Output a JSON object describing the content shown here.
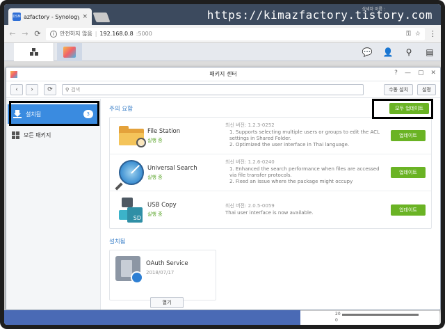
{
  "browser": {
    "tab_title": "azfactory - Synology Di",
    "tab_close": "×",
    "favicon_text": "DSM",
    "watermark": "https://kimazfactory.tistory.com",
    "watermark_small": "상세차 이름 :",
    "security_label": "안전하지 않음",
    "url_host": "192.168.0.8",
    "url_port": ":5000"
  },
  "window": {
    "title": "패키지 센터",
    "search_placeholder": "검색",
    "manual_install": "수동 설치",
    "settings": "설정"
  },
  "sidebar": {
    "installed_label": "설치됨",
    "installed_count": "3",
    "all_packages_label": "모든 패키지"
  },
  "attention": {
    "title": "주의 요함",
    "update_all": "모두 업데이트",
    "packages": [
      {
        "name": "File Station",
        "status": "실행 중",
        "version_line": "최신 버전: 1.2.3-0252",
        "notes": "1. Supports selecting multiple users or groups to edit the ACL settings in Shared Folder.\n2. Optimized the user interface in Thai language.",
        "update": "업데이트"
      },
      {
        "name": "Universal Search",
        "status": "실행 중",
        "version_line": "최신 버전: 1.2.6-0240",
        "notes": "1. Enhanced the search performance when files are accessed via file transfer protocols.\n2. Fixed an issue where the package might occupy",
        "update": "업데이트"
      },
      {
        "name": "USB Copy",
        "status": "실행 중",
        "version_line": "최신 버전: 2.0.5-0059",
        "notes": "Thai user interface is now available.",
        "update": "업데이트"
      }
    ]
  },
  "installed": {
    "title": "설치됨",
    "card": {
      "name": "OAuth Service",
      "date": "2018/07/17",
      "open": "열기"
    }
  },
  "widget": {
    "v1": "20",
    "v2": "0"
  },
  "colors": {
    "accent": "#3a8be0",
    "update_green": "#6ab324",
    "section_blue": "#3a7fc8"
  }
}
